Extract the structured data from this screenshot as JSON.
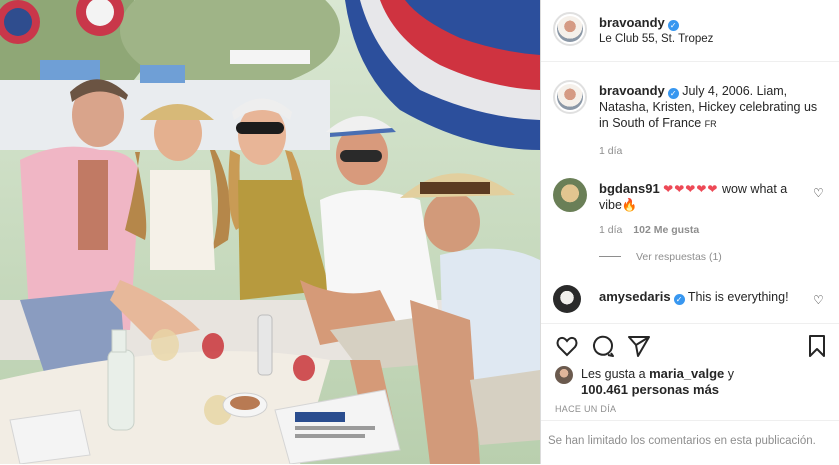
{
  "header": {
    "username": "bravoandy",
    "location": "Le Club 55, St. Tropez"
  },
  "caption": {
    "username": "bravoandy",
    "text": "July 4, 2006. Liam, Natasha, Kristen, Hickey celebrating us in South of France",
    "lang_tag": "FR",
    "time": "1 día"
  },
  "comments": [
    {
      "username": "bgdans91",
      "hearts": "❤❤❤❤❤",
      "text": "wow what a vibe🔥",
      "time": "1 día",
      "likes": "102 Me gusta",
      "replies": "Ver respuestas (1)"
    },
    {
      "username": "amysedaris",
      "text": "This is everything!"
    }
  ],
  "likes": {
    "prefix": "Les gusta a",
    "user": "maria_valge",
    "mid": "y",
    "count": "100.461 personas más"
  },
  "timestamp": "HACE UN DÍA",
  "comments_limited": "Se han limitado los comentarios en esta publicación.",
  "icons": [
    "heart-icon",
    "comment-icon",
    "share-icon",
    "bookmark-icon"
  ],
  "colors": {
    "verified": "#3897f0",
    "heart": "#ed4956",
    "muted": "#8e8e8e"
  }
}
